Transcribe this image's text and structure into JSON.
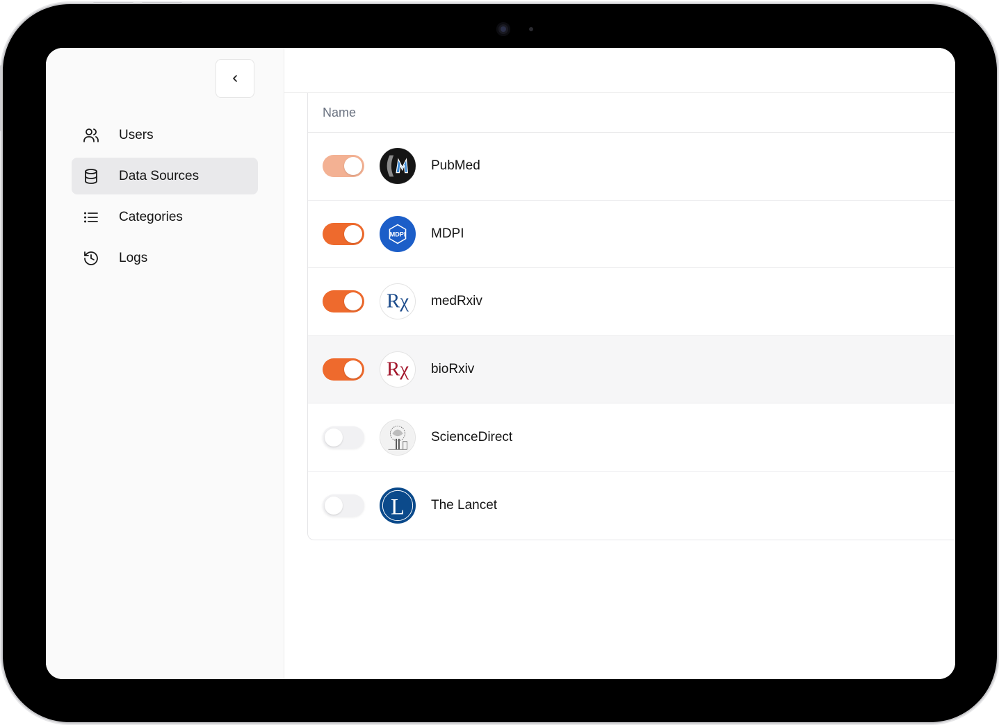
{
  "sidebar": {
    "items": [
      {
        "label": "Users",
        "icon": "users-icon",
        "active": false
      },
      {
        "label": "Data Sources",
        "icon": "database-icon",
        "active": true
      },
      {
        "label": "Categories",
        "icon": "list-icon",
        "active": false
      },
      {
        "label": "Logs",
        "icon": "history-icon",
        "active": false
      }
    ]
  },
  "table": {
    "column_header": "Name",
    "rows": [
      {
        "name": "PubMed",
        "enabled": true,
        "logo_text": "M"
      },
      {
        "name": "MDPI",
        "enabled": true,
        "logo_text": "MDPI"
      },
      {
        "name": "medRxiv",
        "enabled": true,
        "logo_text": "Rχ"
      },
      {
        "name": "bioRxiv",
        "enabled": true,
        "logo_text": "Rχ"
      },
      {
        "name": "ScienceDirect",
        "enabled": false,
        "logo_text": ""
      },
      {
        "name": "The Lancet",
        "enabled": false,
        "logo_text": "L"
      }
    ]
  },
  "colors": {
    "toggle_on": "#ee6a2d",
    "toggle_on_hover": "#f3b193",
    "toggle_off": "#f1f1f3",
    "mdpi_blue": "#1c5ec8",
    "medrxiv_blue": "#1e4d8c",
    "biorxiv_red": "#a3172c",
    "lancet_blue": "#0b4a8b"
  }
}
